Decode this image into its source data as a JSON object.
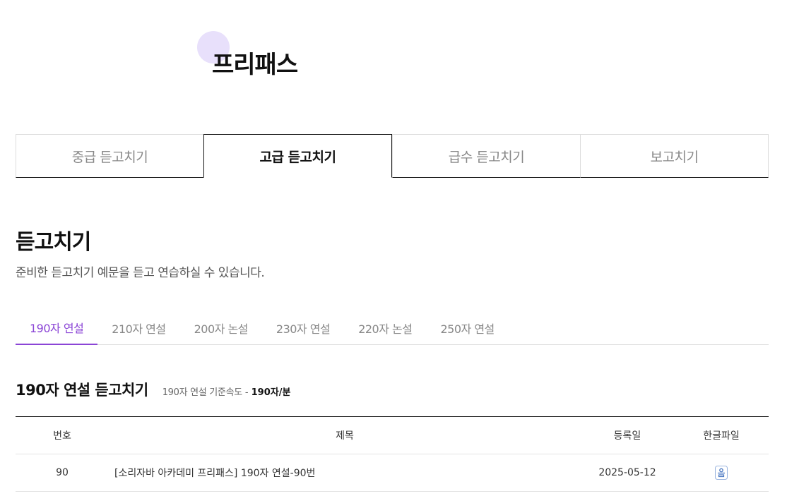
{
  "page": {
    "title": "프리패스"
  },
  "main_tabs": [
    {
      "label": "중급 듣고치기",
      "active": false
    },
    {
      "label": "고급 듣고치기",
      "active": true
    },
    {
      "label": "급수 듣고치기",
      "active": false
    },
    {
      "label": "보고치기",
      "active": false
    }
  ],
  "section": {
    "title": "듣고치기",
    "description": "준비한 듣고치기 예문을 듣고 연습하실 수 있습니다."
  },
  "sub_tabs": [
    {
      "label": "190자 연설",
      "active": true
    },
    {
      "label": "210자 연설",
      "active": false
    },
    {
      "label": "200자 논설",
      "active": false
    },
    {
      "label": "230자 연설",
      "active": false
    },
    {
      "label": "220자 논설",
      "active": false
    },
    {
      "label": "250자 연설",
      "active": false
    }
  ],
  "list": {
    "title": "190자 연설 듣고치기",
    "speed_label": "190자 연설 기준속도",
    "speed_separator": "-",
    "speed_value": "190자/분"
  },
  "table": {
    "headers": {
      "no": "번호",
      "title": "제목",
      "date": "등록일",
      "file": "한글파일"
    },
    "rows": [
      {
        "no": "90",
        "title": "[소리자바 아카데미 프리패스] 190자 연설-90번",
        "date": "2025-05-12",
        "file_icon": "hwp-file-icon"
      }
    ]
  },
  "colors": {
    "accent": "#8b45d6",
    "title_dot": "#e8e0fb",
    "file_icon": "#4a78c2"
  }
}
